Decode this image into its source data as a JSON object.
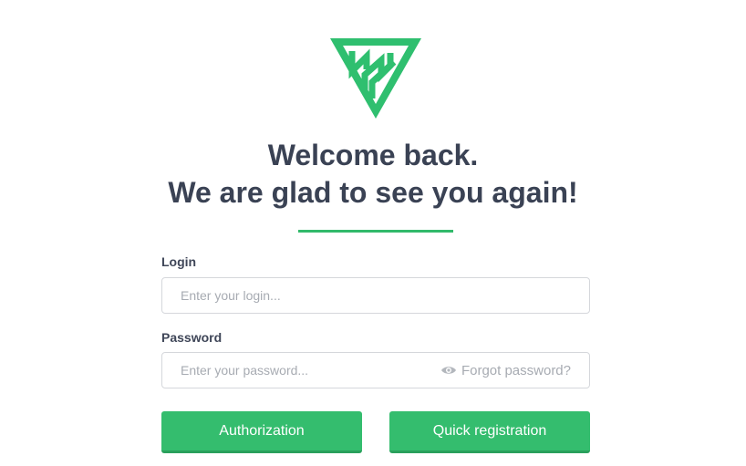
{
  "brand": {
    "logo_icon": "triangle-monogram-logo",
    "accent_color": "#34bd6e"
  },
  "heading": {
    "line1": "Welcome back.",
    "line2": "We are glad to see you again!"
  },
  "form": {
    "login": {
      "label": "Login",
      "placeholder": "Enter your login...",
      "value": ""
    },
    "password": {
      "label": "Password",
      "placeholder": "Enter your password...",
      "value": "",
      "show_icon": "eye-icon",
      "forgot_label": "Forgot password?"
    }
  },
  "buttons": {
    "authorization": "Authorization",
    "quick_registration": "Quick registration"
  }
}
